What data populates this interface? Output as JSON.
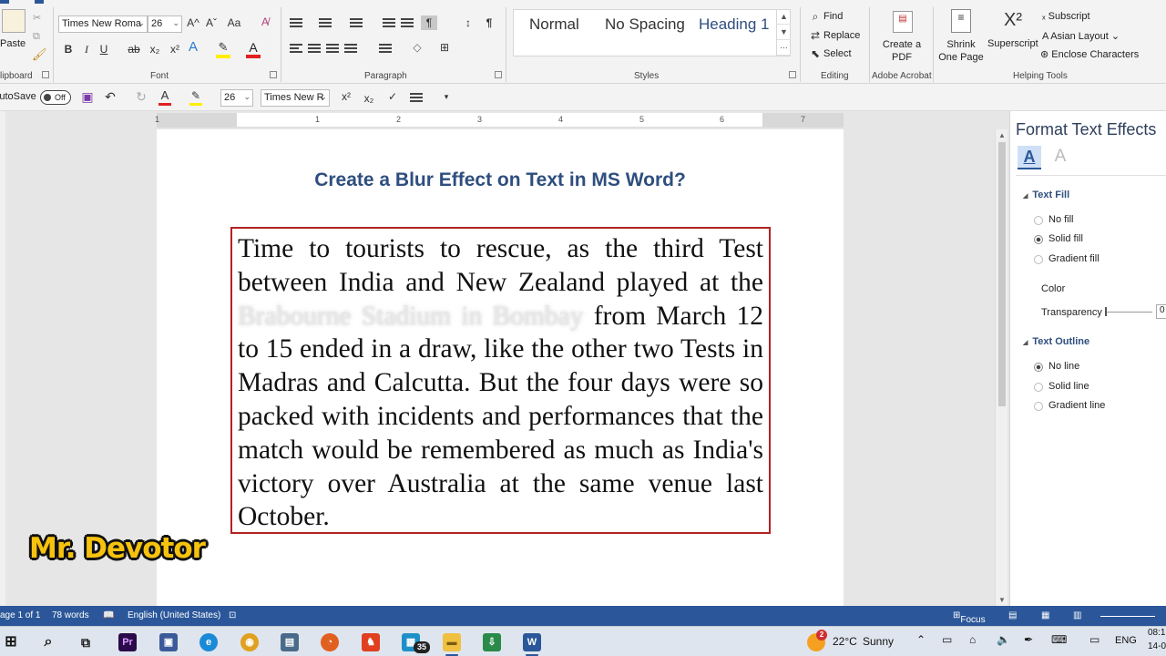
{
  "ribbon": {
    "clipboard": {
      "paste": "Paste",
      "label": "lipboard"
    },
    "font": {
      "label": "Font",
      "font_name": "Times New Roma",
      "font_size": "26",
      "grow": "A^",
      "shrink": "Aˇ",
      "case": "Aa",
      "bold": "B",
      "italic": "I",
      "underline": "U",
      "strike": "ab",
      "sub": "x₂",
      "sup": "x²"
    },
    "paragraph": {
      "label": "Paragraph"
    },
    "styles": {
      "label": "Styles",
      "items": [
        "Normal",
        "No Spacing",
        "Heading 1"
      ]
    },
    "editing": {
      "label": "Editing",
      "find": "Find",
      "replace": "Replace",
      "select": "Select"
    },
    "acrobat": {
      "label": "Adobe Acrobat",
      "create_pdf": "Create a PDF"
    },
    "helping": {
      "label": "Helping Tools",
      "shrink": "Shrink One Page",
      "superscript": "Superscript",
      "subscript": "Subscript",
      "asian_layout": "Asian Layout",
      "enclose": "Enclose Characters"
    }
  },
  "qat": {
    "autosave": "AutoSave",
    "toggle": "Off",
    "font_size": "26",
    "font_name": "Times New R"
  },
  "ruler": {
    "numbers": [
      "1",
      "1",
      "2",
      "3",
      "4",
      "5",
      "6",
      "7"
    ]
  },
  "document": {
    "title": "Create a Blur Effect on Text in MS Word?",
    "text_before": "Time to tourists to rescue, as the third Test between India and New Zealand played at the ",
    "text_blurred": "Brabourne Stadium in Bombay",
    "text_after": " from March 12 to 15 ended in a draw, like the other two Tests in Madras and Calcutta. But the four days were so packed with incidents and performances that the match would be remembered as much as India's victory over Australia at the same venue last October."
  },
  "watermark": "Mr. Devotor",
  "format_pane": {
    "title": "Format Text Effects",
    "tab_fill_icon": "A",
    "tab_effects_icon": "A",
    "text_fill": "Text Fill",
    "fill_options": [
      "No fill",
      "Solid fill",
      "Gradient fill"
    ],
    "fill_selected": "Solid fill",
    "color_label": "Color",
    "transparency_label": "Transparency",
    "transparency_value": "0",
    "text_outline": "Text Outline",
    "outline_options": [
      "No line",
      "Solid line",
      "Gradient line"
    ],
    "outline_selected": "No line"
  },
  "status": {
    "page": "age 1 of 1",
    "words": "78 words",
    "language": "English (United States)",
    "focus": "Focus"
  },
  "taskbar": {
    "weather_temp": "22°C",
    "weather_desc": "Sunny",
    "weather_badge": "2",
    "lang": "ENG",
    "time": "08:1",
    "date": "14-0",
    "badge_35": "35"
  },
  "colors": {
    "accent": "#2b579a",
    "title": "#2e4e7e",
    "box_border": "#b22222",
    "watermark": "#f6c20e"
  }
}
